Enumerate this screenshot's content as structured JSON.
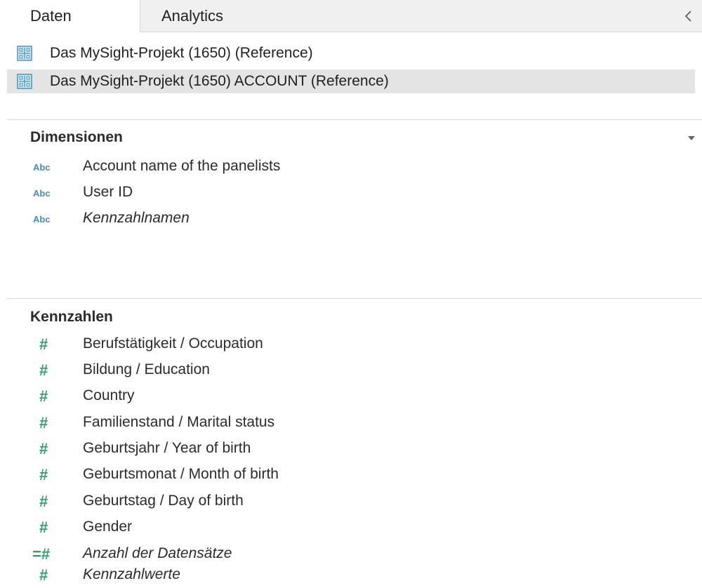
{
  "tabs": {
    "data": "Daten",
    "analytics": "Analytics"
  },
  "datasources": [
    {
      "label": "Das MySight-Projekt (1650) (Reference)",
      "selected": false
    },
    {
      "label": "Das MySight-Projekt (1650) ACCOUNT (Reference)",
      "selected": true
    }
  ],
  "dimensions": {
    "header": "Dimensionen",
    "type_label": "Abc",
    "items": [
      {
        "label": "Account name of the panelists",
        "italic": false
      },
      {
        "label": "User ID",
        "italic": false
      },
      {
        "label": "Kennzahlnamen",
        "italic": true
      }
    ]
  },
  "measures": {
    "header": "Kennzahlen",
    "type_label": "#",
    "calc_type_label": "=#",
    "items": [
      {
        "label": "Berufstätigkeit / Occupation",
        "italic": false
      },
      {
        "label": "Bildung / Education",
        "italic": false
      },
      {
        "label": "Country",
        "italic": false
      },
      {
        "label": "Familienstand / Marital status",
        "italic": false
      },
      {
        "label": "Geburtsjahr / Year of birth",
        "italic": false
      },
      {
        "label": "Geburtsmonat / Month of birth",
        "italic": false
      },
      {
        "label": "Geburtstag / Day of birth",
        "italic": false
      },
      {
        "label": "Gender",
        "italic": false
      },
      {
        "label": "Anzahl der Datensätze",
        "italic": true,
        "calculated": true
      },
      {
        "label": "Kennzahlwerte",
        "italic": true
      }
    ]
  },
  "colors": {
    "dimension_type": "#4a8cb1",
    "measure_type": "#2e9e6b",
    "selected_row": "#e4e4e4",
    "inactive_tab": "#f0f0f0"
  },
  "icons": {
    "collapse": "chevron-left-icon",
    "datasource": "datasource-cube-icon",
    "menu": "caret-down-icon"
  }
}
